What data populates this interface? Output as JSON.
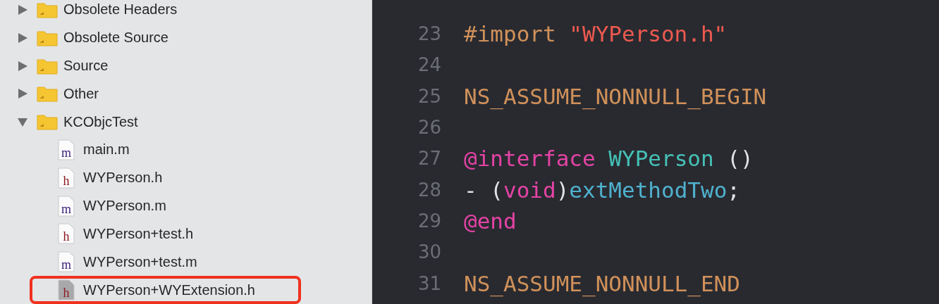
{
  "navigator": {
    "items": [
      {
        "kind": "folder",
        "label": "Obsolete Headers",
        "expanded": false
      },
      {
        "kind": "folder",
        "label": "Obsolete Source",
        "expanded": false
      },
      {
        "kind": "folder",
        "label": "Source",
        "expanded": false
      },
      {
        "kind": "folder",
        "label": "Other",
        "expanded": false
      },
      {
        "kind": "folder",
        "label": "KCObjcTest",
        "expanded": true,
        "children": [
          {
            "kind": "file",
            "badge": "m",
            "label": "main.m",
            "highlighted": false
          },
          {
            "kind": "file",
            "badge": "h",
            "label": "WYPerson.h",
            "highlighted": false
          },
          {
            "kind": "file",
            "badge": "m",
            "label": "WYPerson.m",
            "highlighted": false
          },
          {
            "kind": "file",
            "badge": "h",
            "label": "WYPerson+test.h",
            "highlighted": false
          },
          {
            "kind": "file",
            "badge": "m",
            "label": "WYPerson+test.m",
            "highlighted": false
          },
          {
            "kind": "file",
            "badge": "h",
            "label": "WYPerson+WYExtension.h",
            "highlighted": true
          }
        ]
      }
    ]
  },
  "editor": {
    "lines": [
      {
        "number": "23",
        "tokens": [
          {
            "kind": "preprocessor",
            "text": "#import "
          },
          {
            "kind": "string",
            "text": "\"WYPerson.h\""
          }
        ]
      },
      {
        "number": "24"
      },
      {
        "number": "25",
        "tokens": [
          {
            "kind": "preprocessor",
            "text": "NS_ASSUME_NONNULL_BEGIN"
          }
        ]
      },
      {
        "number": "26"
      },
      {
        "number": "27",
        "tokens": [
          {
            "kind": "keyword",
            "text": "@interface "
          },
          {
            "kind": "class",
            "text": "WYPerson"
          },
          {
            "kind": "plain",
            "text": " ()"
          }
        ]
      },
      {
        "number": "28",
        "tokens": [
          {
            "kind": "plain",
            "text": "- ("
          },
          {
            "kind": "keyword",
            "text": "void"
          },
          {
            "kind": "plain",
            "text": ")"
          },
          {
            "kind": "method",
            "text": "extMethodTwo"
          },
          {
            "kind": "plain",
            "text": ";"
          }
        ]
      },
      {
        "number": "29",
        "tokens": [
          {
            "kind": "keyword",
            "text": "@end"
          }
        ]
      },
      {
        "number": "30"
      },
      {
        "number": "31",
        "tokens": [
          {
            "kind": "preprocessor",
            "text": "NS_ASSUME_NONNULL_END"
          }
        ]
      }
    ]
  }
}
